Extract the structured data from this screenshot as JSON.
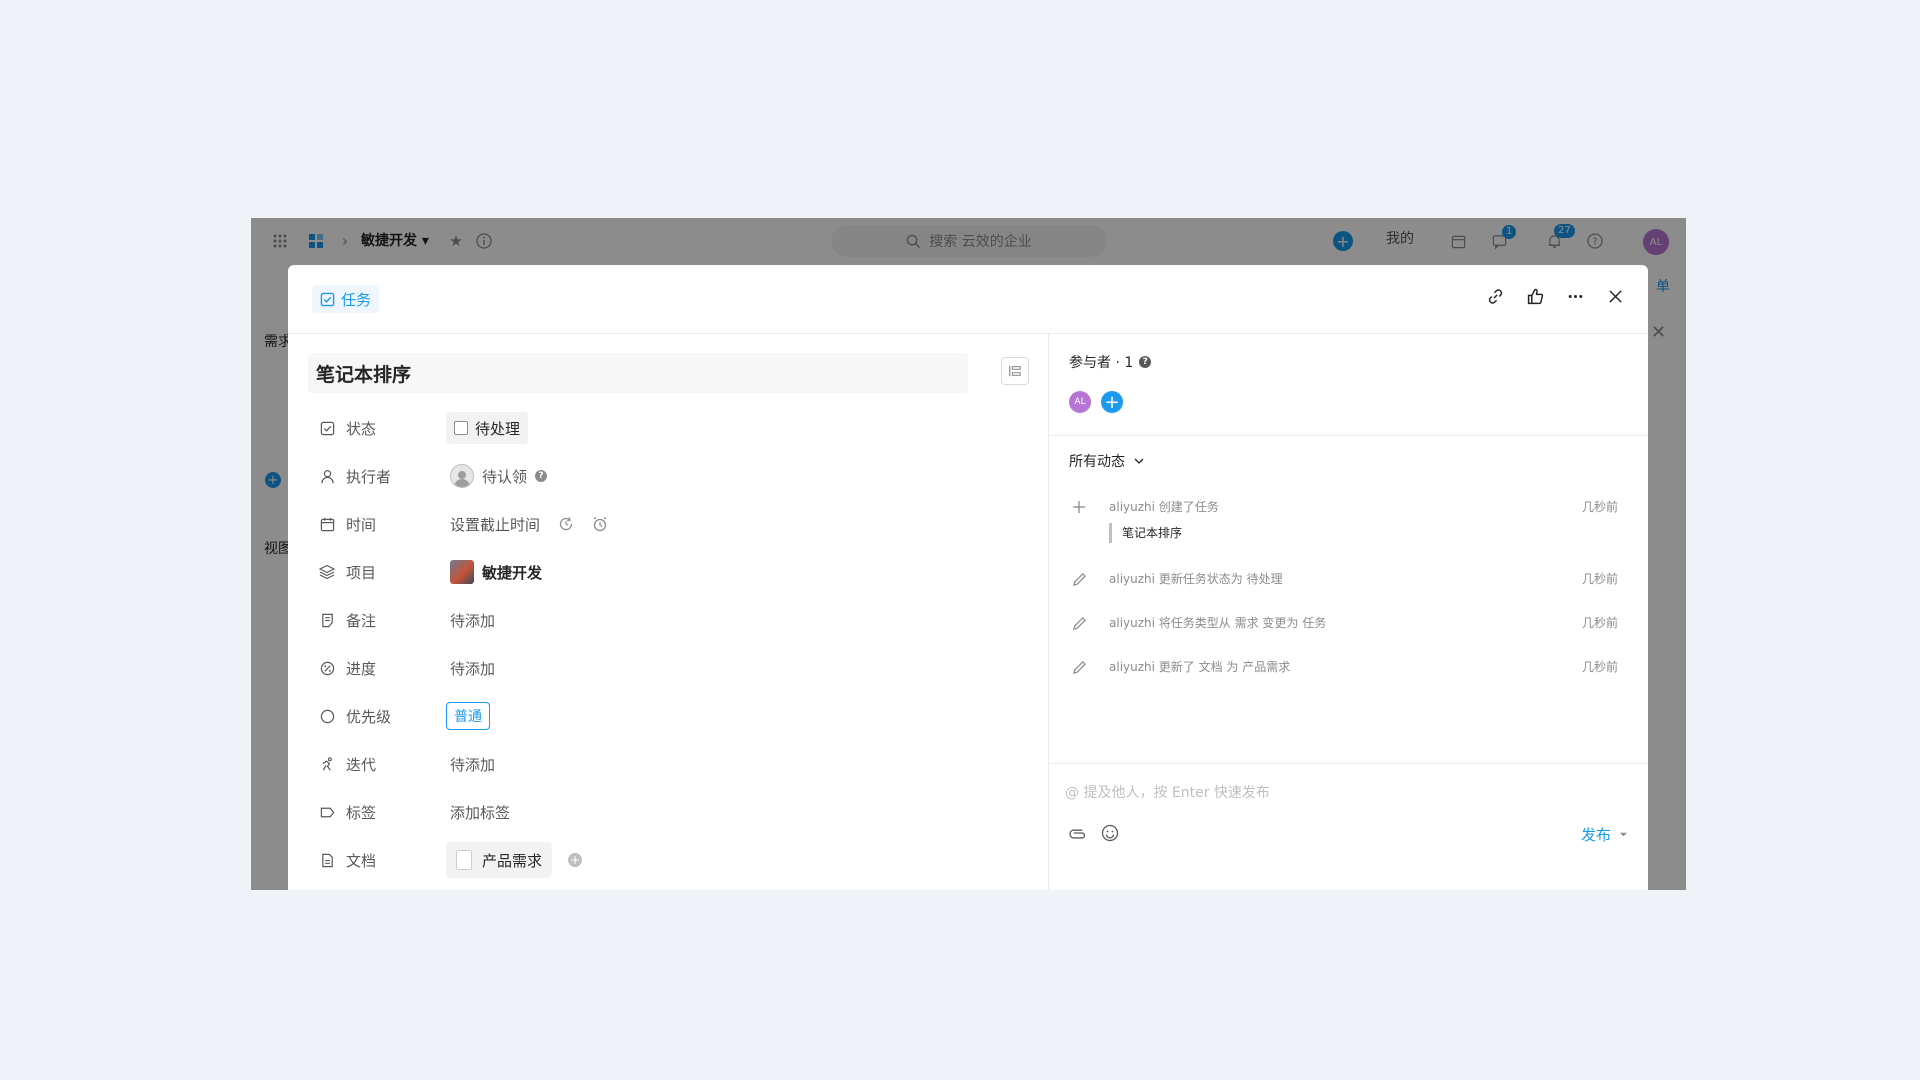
{
  "app": {
    "project_name": "敏捷开发",
    "search_placeholder": "搜索 云效的企业",
    "mine_label": "我的",
    "messages_badge": "1",
    "notifications_badge": "27",
    "user_avatar": "AL",
    "behind_partial_label_1": "需求",
    "behind_partial_label_2": "视图",
    "behind_partial_label_3": "单"
  },
  "modal": {
    "type_label": "任务",
    "title": "笔记本排序",
    "fields": [
      {
        "label": "状态",
        "icon": "checkbox-icon",
        "value": "待处理"
      },
      {
        "label": "执行者",
        "icon": "user-icon",
        "value": "待认领"
      },
      {
        "label": "时间",
        "icon": "calendar-icon",
        "value": "设置截止时间"
      },
      {
        "label": "项目",
        "icon": "layers-icon",
        "value": "敏捷开发"
      },
      {
        "label": "备注",
        "icon": "note-icon",
        "value": "待添加"
      },
      {
        "label": "进度",
        "icon": "percent-icon",
        "value": "待添加"
      },
      {
        "label": "优先级",
        "icon": "circle-icon",
        "value": "普通"
      },
      {
        "label": "迭代",
        "icon": "sprint-icon",
        "value": "待添加"
      },
      {
        "label": "标签",
        "icon": "tag-icon",
        "value": "添加标签"
      },
      {
        "label": "文档",
        "icon": "document-icon",
        "value": "产品需求"
      }
    ]
  },
  "participants": {
    "title": "参与者 · 1",
    "avatars": [
      "AL"
    ]
  },
  "activity": {
    "filter_label": "所有动态",
    "items": [
      {
        "icon": "plus-icon",
        "text": "aliyuzhi 创建了任务",
        "quote": "笔记本排序",
        "time": "几秒前"
      },
      {
        "icon": "pencil-icon",
        "text": "aliyuzhi 更新任务状态为 待处理",
        "time": "几秒前"
      },
      {
        "icon": "pencil-icon",
        "text": "aliyuzhi 将任务类型从 需求 变更为 任务",
        "time": "几秒前"
      },
      {
        "icon": "pencil-icon",
        "text": "aliyuzhi 更新了 文档 为 产品需求",
        "time": "几秒前"
      }
    ]
  },
  "comment": {
    "placeholder": "@ 提及他人，按 Enter 快速发布",
    "publish_label": "发布"
  },
  "colors": {
    "accent": "#1b9aee",
    "background": "#eff3f8",
    "avatar": "#b675d4"
  }
}
